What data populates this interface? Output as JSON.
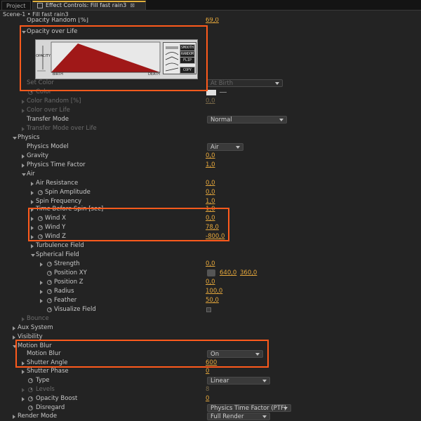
{
  "tabs": [
    {
      "label": "Project"
    },
    {
      "label": "Effect Controls: Fill fast rain3"
    }
  ],
  "breadcrumb": "Scene-1 • Fill fast rain3",
  "top_cut_row": {
    "label": "Opacity Random [%]",
    "value": "69,0"
  },
  "opacity_over_life": {
    "label": "Opacity over Life",
    "graph_y_label": "OPACITY",
    "graph_x_start": "BIRTH",
    "graph_x_end": "DEATH",
    "buttons": [
      "SMOOTH",
      "RANDOM",
      "FLIP",
      "COPY"
    ]
  },
  "rows": {
    "set_color": {
      "label": "Set Color",
      "value": "At Birth"
    },
    "color": {
      "label": "Color"
    },
    "color_random": {
      "label": "Color Random [%]",
      "value": "0,0"
    },
    "color_over_life": {
      "label": "Color over Life"
    },
    "transfer_mode": {
      "label": "Transfer Mode",
      "value": "Normal"
    },
    "transfer_mode_over_life": {
      "label": "Transfer Mode over Life"
    },
    "physics": {
      "label": "Physics"
    },
    "physics_model": {
      "label": "Physics Model",
      "value": "Air"
    },
    "gravity": {
      "label": "Gravity",
      "value": "0,0"
    },
    "physics_time_factor": {
      "label": "Physics Time Factor",
      "value": "1,0"
    },
    "air": {
      "label": "Air"
    },
    "air_resistance": {
      "label": "Air Resistance",
      "value": "0,0"
    },
    "spin_amplitude": {
      "label": "Spin Amplitude",
      "value": "0,0"
    },
    "spin_frequency": {
      "label": "Spin Frequency",
      "value": "1,0"
    },
    "time_before_spin": {
      "label": "Time Before Spin [sec]",
      "value": "1,0"
    },
    "wind_x": {
      "label": "Wind X",
      "value": "0,0"
    },
    "wind_y": {
      "label": "Wind Y",
      "value": "78,0"
    },
    "wind_z": {
      "label": "Wind Z",
      "value": "-800,0"
    },
    "turbulence_field": {
      "label": "Turbulence Field"
    },
    "spherical_field": {
      "label": "Spherical Field"
    },
    "strength": {
      "label": "Strength",
      "value": "0,0"
    },
    "position_xy": {
      "label": "Position XY",
      "value_x": "640,0",
      "value_y": "360,0"
    },
    "position_z": {
      "label": "Position Z",
      "value": "0,0"
    },
    "radius": {
      "label": "Radius",
      "value": "100,0"
    },
    "feather": {
      "label": "Feather",
      "value": "50,0"
    },
    "visualize_field": {
      "label": "Visualize Field"
    },
    "bounce": {
      "label": "Bounce"
    },
    "aux_system": {
      "label": "Aux System"
    },
    "visibility": {
      "label": "Visibility"
    },
    "motion_blur_group": {
      "label": "Motion Blur"
    },
    "motion_blur": {
      "label": "Motion Blur",
      "value": "On"
    },
    "shutter_angle": {
      "label": "Shutter Angle",
      "value": "600"
    },
    "shutter_phase": {
      "label": "Shutter Phase",
      "value": "0"
    },
    "type": {
      "label": "Type",
      "value": "Linear"
    },
    "levels": {
      "label": "Levels",
      "value": "8"
    },
    "opacity_boost": {
      "label": "Opacity Boost",
      "value": "0"
    },
    "disregard": {
      "label": "Disregard",
      "value": "Physics Time Factor (PTF)"
    },
    "render_mode": {
      "label": "Render Mode",
      "value": "Full Render"
    }
  },
  "colors": {
    "accent": "#e3b13b",
    "value": "#e6a83c",
    "highlight": "#ff5a1c",
    "graph_fill": "#a01818"
  }
}
